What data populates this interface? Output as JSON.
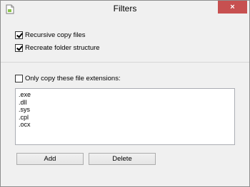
{
  "window": {
    "title": "Filters",
    "close_glyph": "×"
  },
  "options": {
    "recursive_copy": {
      "label": "Recursive copy files",
      "checked": true
    },
    "recreate_structure": {
      "label": "Recreate folder structure",
      "checked": true
    },
    "only_extensions": {
      "label": "Only copy these file extensions:",
      "checked": false
    }
  },
  "extensions": [
    ".exe",
    ".dll",
    ".sys",
    ".cpl",
    ".ocx"
  ],
  "buttons": {
    "add": "Add",
    "delete": "Delete"
  }
}
